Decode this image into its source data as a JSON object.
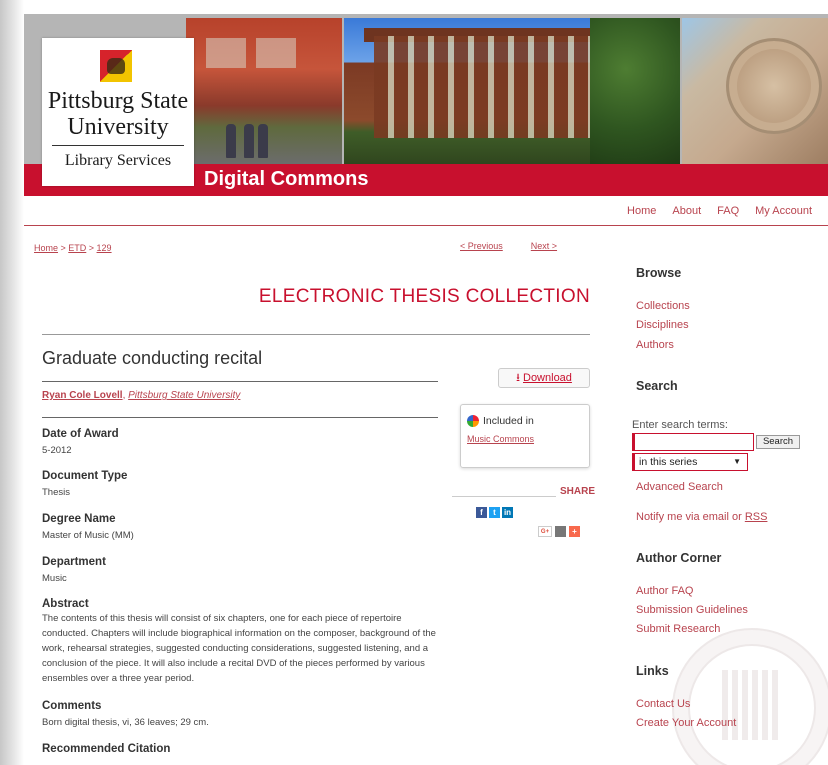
{
  "colors": {
    "brand_red": "#c8102e",
    "link": "#b8434e"
  },
  "branding": {
    "line1": "Pittsburg State",
    "line2": "University",
    "line3": "Library Services",
    "site_title": "Digital Commons"
  },
  "topnav": [
    {
      "label": "Home"
    },
    {
      "label": "About"
    },
    {
      "label": "FAQ"
    },
    {
      "label": "My Account"
    }
  ],
  "breadcrumb": {
    "home": "Home",
    "sep1": " > ",
    "etd": "ETD",
    "sep2": " > ",
    "current": "129"
  },
  "pager": {
    "previous": "< Previous",
    "next": "Next >"
  },
  "collection_title": "ELECTRONIC THESIS COLLECTION",
  "document": {
    "title": "Graduate conducting recital",
    "author_name": "Ryan Cole Lovell",
    "author_sep": ", ",
    "author_affiliation": "Pittsburg State University",
    "fields": [
      {
        "label": "Date of Award",
        "value": "5-2012"
      },
      {
        "label": "Document Type",
        "value": "Thesis"
      },
      {
        "label": "Degree Name",
        "value": "Master of Music (MM)"
      },
      {
        "label": "Department",
        "value": "Music"
      },
      {
        "label": "Abstract",
        "value": "The contents of this thesis will consist of six chapters, one for each piece of repertoire conducted. Chapters will include biographical information on the composer, background of the work, rehearsal strategies, suggested conducting considerations, suggested listening, and a conclusion of the piece. It will also include a recital DVD of the pieces performed by various ensembles over a three year period."
      },
      {
        "label": "Comments",
        "value": "Born digital thesis, vi, 36 leaves; 29 cm."
      },
      {
        "label": "Recommended Citation",
        "value": ""
      }
    ]
  },
  "actions": {
    "download_icon": "download-arrow-icon",
    "download": "Download",
    "included_in": "Included in",
    "included_link": "Music Commons",
    "share": "SHARE",
    "share_icons": [
      "facebook",
      "twitter",
      "linkedin",
      "google-plus",
      "email",
      "addthis"
    ],
    "share_glyphs": {
      "facebook": "f",
      "twitter": "t",
      "linkedin": "in",
      "google_plus": "G+",
      "email": "",
      "addthis": "+"
    }
  },
  "sidebar": {
    "browse_heading": "Browse",
    "browse_links": [
      "Collections",
      "Disciplines",
      "Authors"
    ],
    "search_heading": "Search",
    "search_label": "Enter search terms:",
    "search_value": "",
    "search_button": "Search",
    "scope_selected": "in this series",
    "advanced_search": "Advanced Search",
    "notify_prefix": "Notify me via email or ",
    "notify_rss": "RSS",
    "author_heading": "Author Corner",
    "author_links": [
      "Author FAQ",
      "Submission Guidelines",
      "Submit Research"
    ],
    "links_heading": "Links",
    "links": [
      "Contact Us",
      "Create Your Account"
    ]
  }
}
